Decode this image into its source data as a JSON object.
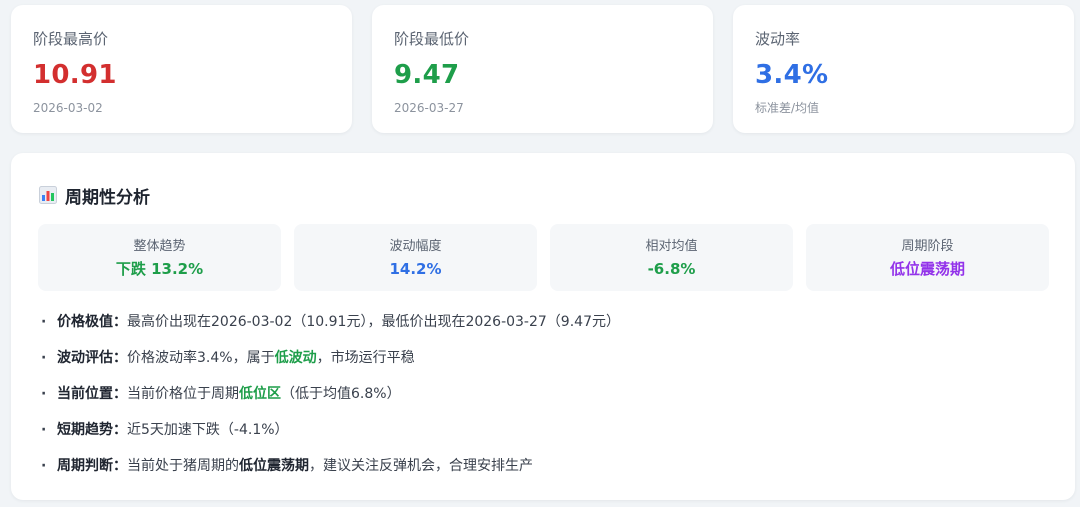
{
  "colors": {
    "red": "#d32f2f",
    "green": "#1e9e4a",
    "blue": "#2f6fe4",
    "purple": "#9333ea"
  },
  "stats": [
    {
      "label": "阶段最高价",
      "value": "10.91",
      "sub": "2026-03-02",
      "color": "red"
    },
    {
      "label": "阶段最低价",
      "value": "9.47",
      "sub": "2026-03-27",
      "color": "green"
    },
    {
      "label": "波动率",
      "value": "3.4%",
      "sub": "标准差/均值",
      "color": "blue"
    }
  ],
  "analysis": {
    "icon": "bar-chart-icon",
    "title": "周期性分析",
    "metrics": [
      {
        "label": "整体趋势",
        "value": "下跌 13.2%",
        "color": "green"
      },
      {
        "label": "波动幅度",
        "value": "14.2%",
        "color": "blue"
      },
      {
        "label": "相对均值",
        "value": "-6.8%",
        "color": "green"
      },
      {
        "label": "周期阶段",
        "value": "低位震荡期",
        "color": "purple"
      }
    ],
    "notes": [
      {
        "bullet": "·",
        "key": "价格极值：",
        "pre": "最高价出现在2026-03-02（10.91元），最低价出现在2026-03-27（9.47元）",
        "highlight": "",
        "post": ""
      },
      {
        "bullet": "·",
        "key": "波动评估：",
        "pre": "价格波动率3.4%，属于",
        "highlight": "低波动",
        "post": "，市场运行平稳"
      },
      {
        "bullet": "·",
        "key": "当前位置：",
        "pre": "当前价格位于周期",
        "highlight": "低位区",
        "post": "（低于均值6.8%）"
      },
      {
        "bullet": "·",
        "key": "短期趋势：",
        "pre": "近5天加速下跌（-4.1%）",
        "highlight": "",
        "post": ""
      },
      {
        "bullet": "·",
        "key": "周期判断：",
        "pre": "当前处于猪周期的",
        "highlight": "低位震荡期",
        "post": "，建议关注反弹机会，合理安排生产"
      }
    ],
    "note_highlight_colors": [
      "",
      "green",
      "green",
      "",
      "dark"
    ]
  }
}
